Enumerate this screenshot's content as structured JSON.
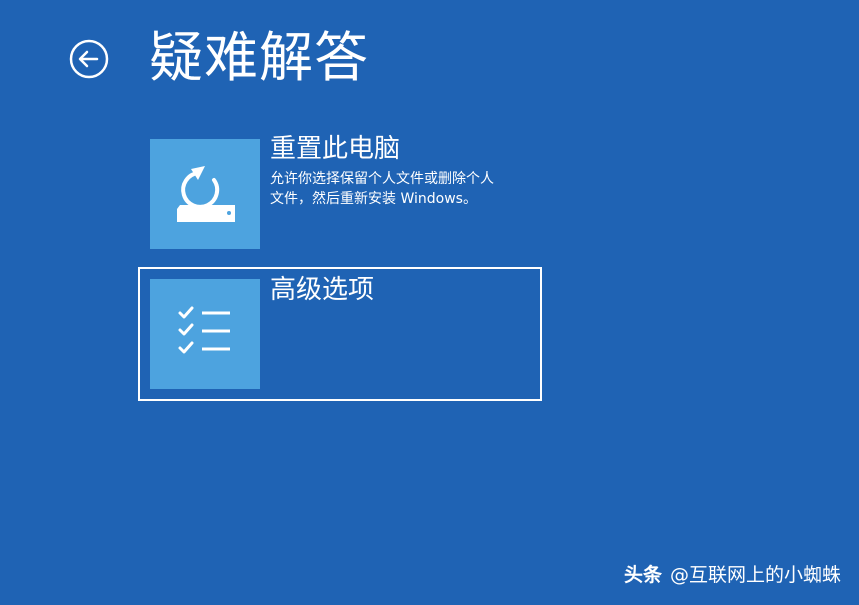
{
  "page": {
    "title": "疑难解答",
    "background_color": "#1f63b4"
  },
  "back_button": {
    "icon": "back-arrow-circle-icon"
  },
  "options": [
    {
      "icon": "reset-pc-icon",
      "title": "重置此电脑",
      "description_lines": [
        "允许你选择保留个人文件或删除个人",
        "文件，然后重新安装 Windows。"
      ],
      "selected": false
    },
    {
      "icon": "checklist-icon",
      "title": "高级选项",
      "selected": true
    }
  ],
  "colors": {
    "tile": "#4da3df",
    "text": "#ffffff"
  },
  "watermark": {
    "brand": "头条",
    "handle": "@互联网上的小蜘蛛"
  }
}
